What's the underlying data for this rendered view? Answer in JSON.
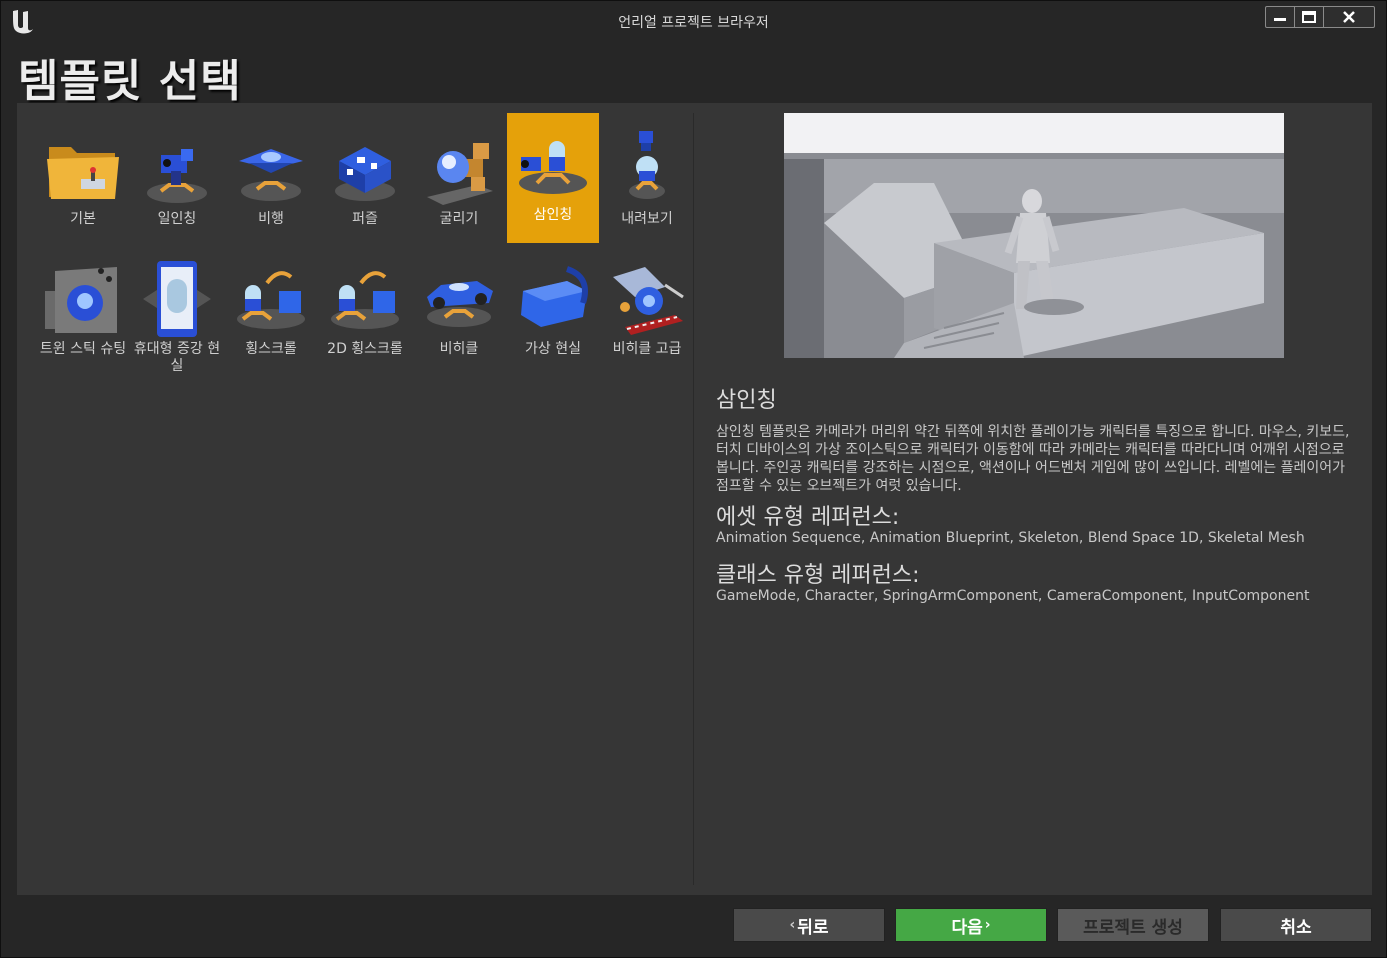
{
  "window": {
    "title": "언리얼 프로젝트 브라우저"
  },
  "page": {
    "title": "템플릿 선택"
  },
  "templates": [
    {
      "label": "기본",
      "icon": "folder-icon"
    },
    {
      "label": "일인칭",
      "icon": "first-person-icon"
    },
    {
      "label": "비행",
      "icon": "flying-icon"
    },
    {
      "label": "퍼즐",
      "icon": "puzzle-icon"
    },
    {
      "label": "굴리기",
      "icon": "rolling-icon"
    },
    {
      "label": "삼인칭",
      "icon": "third-person-icon",
      "selected": true
    },
    {
      "label": "내려보기",
      "icon": "top-down-icon"
    },
    {
      "label": "트윈 스틱 슈팅",
      "icon": "twin-stick-icon"
    },
    {
      "label": "휴대형 증강 현실",
      "icon": "handheld-ar-icon"
    },
    {
      "label": "횡스크롤",
      "icon": "side-scroller-icon"
    },
    {
      "label": "2D 횡스크롤",
      "icon": "2d-side-scroller-icon"
    },
    {
      "label": "비히클",
      "icon": "vehicle-icon"
    },
    {
      "label": "가상 현실",
      "icon": "vr-headset-icon"
    },
    {
      "label": "비히클 고급",
      "icon": "vehicle-advanced-icon"
    }
  ],
  "detail": {
    "title": "삼인칭",
    "description": "삼인칭 템플릿은 카메라가 머리위 약간 뒤쪽에 위치한 플레이가능 캐릭터를 특징으로 합니다. 마우스, 키보드, 터치 디바이스의 가상 조이스틱으로 캐릭터가 이동함에 따라 카메라는 캐릭터를 따라다니며 어깨위 시점으로 봅니다. 주인공 캐릭터를 강조하는 시점으로, 액션이나 어드벤처 게임에 많이 쓰입니다. 레벨에는 플레이어가 점프할 수 있는 오브젝트가 여럿 있습니다.",
    "asset_heading": "에셋 유형 레퍼런스:",
    "asset_types": "Animation Sequence, Animation Blueprint, Skeleton, Blend Space 1D, Skeletal Mesh",
    "class_heading": "클래스 유형 레퍼런스:",
    "class_types": "GameMode, Character, SpringArmComponent, CameraComponent, InputComponent"
  },
  "footer": {
    "back": "뒤로",
    "next": "다음",
    "create": "프로젝트 생성",
    "cancel": "취소",
    "back_arrow": "‹",
    "next_arrow": "›"
  },
  "colors": {
    "accent_selected": "#e5a10a",
    "next_green": "#45a845"
  }
}
